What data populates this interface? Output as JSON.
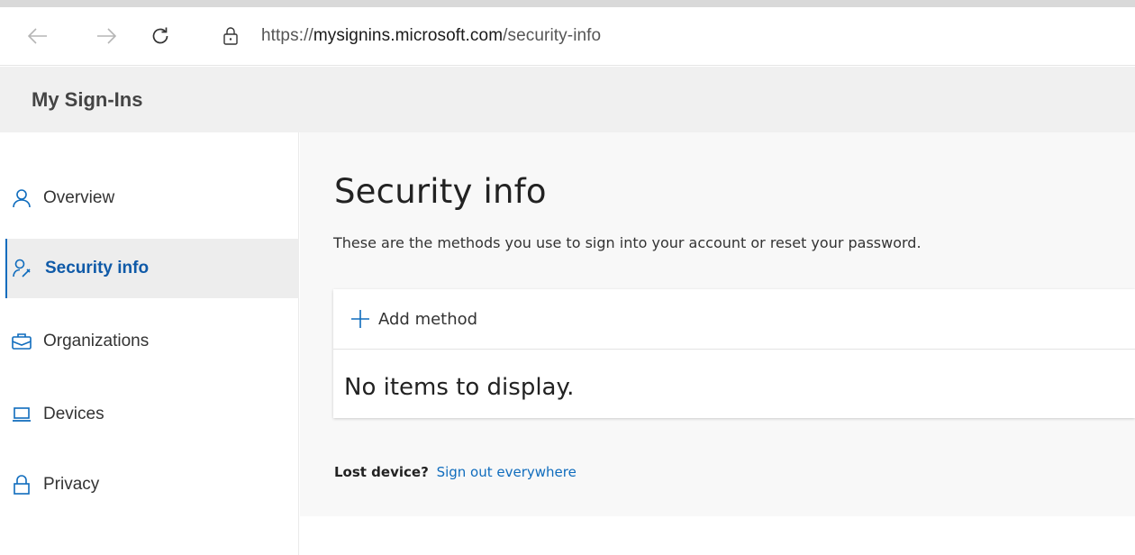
{
  "browser": {
    "url_prefix": "https://",
    "url_domain": "mysignins.microsoft.com",
    "url_path": "/security-info",
    "icons": [
      "back-arrow-icon",
      "forward-arrow-icon",
      "refresh-icon",
      "lock-icon"
    ]
  },
  "header": {
    "title": "My Sign-Ins"
  },
  "sidebar": {
    "items": [
      {
        "label": "Overview",
        "icon": "person-icon",
        "active": false
      },
      {
        "label": "Security info",
        "icon": "person-key-icon",
        "active": true
      },
      {
        "label": "Organizations",
        "icon": "briefcase-icon",
        "active": false
      },
      {
        "label": "Devices",
        "icon": "laptop-icon",
        "active": false
      },
      {
        "label": "Privacy",
        "icon": "lock-icon",
        "active": false
      }
    ]
  },
  "main": {
    "title": "Security info",
    "description": "These are the methods you use to sign into your account or reset your password.",
    "add_method_label": "Add method",
    "empty_message": "No items to display.",
    "lost_device_label": "Lost device?",
    "sign_out_link": "Sign out everywhere"
  },
  "colors": {
    "accent": "#0f6cbd",
    "header_bg": "#f0f0f0",
    "main_bg": "#f8f8f8",
    "active_item_bg": "#ededed"
  }
}
